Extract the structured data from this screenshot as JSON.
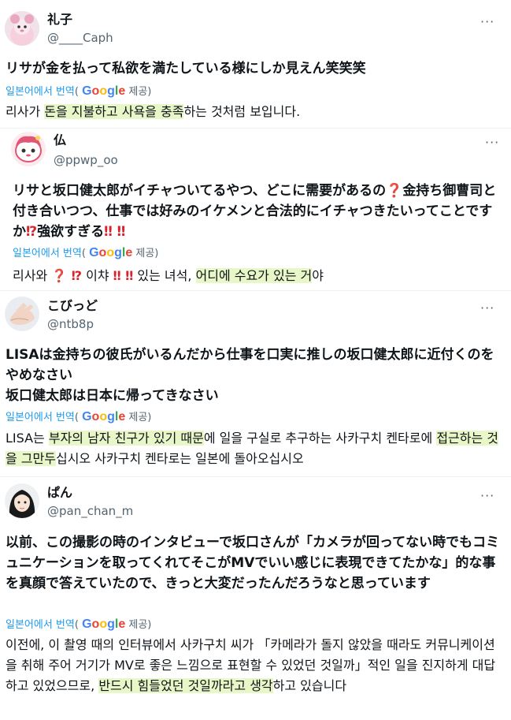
{
  "translation": {
    "label": "일본어에서 번역",
    "open_paren": "(",
    "provided_by": "제공)",
    "google": [
      "G",
      "o",
      "o",
      "g",
      "l",
      "e"
    ],
    "google_colors": [
      "#4285f4",
      "#ea4335",
      "#fbbc05",
      "#4285f4",
      "#34a853",
      "#ea4335"
    ]
  },
  "posts": [
    {
      "name": "礼子",
      "handle": "@____Caph",
      "more": "···",
      "original": "リサが金を払って私欲を満たしている様にしか見えん笑笑笑",
      "ko": {
        "p1": "리사가 ",
        "h1": "돈을 지불하고 사욕을 충족",
        "p2": "하는 것처럼 보입니다."
      }
    },
    {
      "name": "仏",
      "handle": "@ppwp_oo",
      "more": "···",
      "original": {
        "a": "リサと坂口健太郎がイチャついてるやつ、どこに需要があるの",
        "q1": "❓",
        "b": "金持ち御曹司と付き合いつつ、仕事では好みのイケメンと合法的にイチャつきたいってことですか",
        "q2": "⁉",
        "c": "強欲すぎる",
        "q3": "‼ ‼"
      },
      "ko": {
        "p1": "리사와 ",
        "q1": "❓ ⁉",
        "p2": " 이챠 ",
        "q2": "‼ ‼",
        "p3": " 있는 녀석, ",
        "h1": "어디에 수요가 있는 거",
        "p4": "야"
      }
    },
    {
      "name": "こびっど",
      "handle": "@ntb8p",
      "more": "···",
      "original": {
        "line1": "LISAは金持ちの彼氏がいるんだから仕事を口実に推しの坂口健太郎に近付くのをやめなさい",
        "line2": "坂口健太郎は日本に帰ってきなさい"
      },
      "ko": {
        "p1": "LISA는 ",
        "h1": "부자의 남자 친구가 있기 때문",
        "p2": "에 일을 구실로 추구하는 사카구치 켄타로에 ",
        "h2": "접근하는 것을 그만두",
        "p3": "십시오 사카구치 켄타로는 일본에 돌아오십시오"
      }
    },
    {
      "name": "ぱん",
      "handle": "@pan_chan_m",
      "more": "···",
      "original": "以前、この撮影の時のインタビューで坂口さんが「カメラが回ってない時でもコミュニケーションを取ってくれてそこがMVでいい感じに表現できてたかな」的な事を真顔で答えていたので、きっと大変だったんだろうなと思っています",
      "ko": {
        "p1": "이전에, 이 촬영 때의 인터뷰에서 사카구치 씨가 「카메라가 돌지 않았을 때라도 커뮤니케이션을 취해 주어 거기가 MV로 좋은 느낌으로 표현할 수 있었던 것일까」적인 일을 진지하게 대답하고 있었으므로, ",
        "h1": "반드시 힘들었던 것일까라고 생각",
        "p2": "하고 있습니다"
      }
    }
  ]
}
